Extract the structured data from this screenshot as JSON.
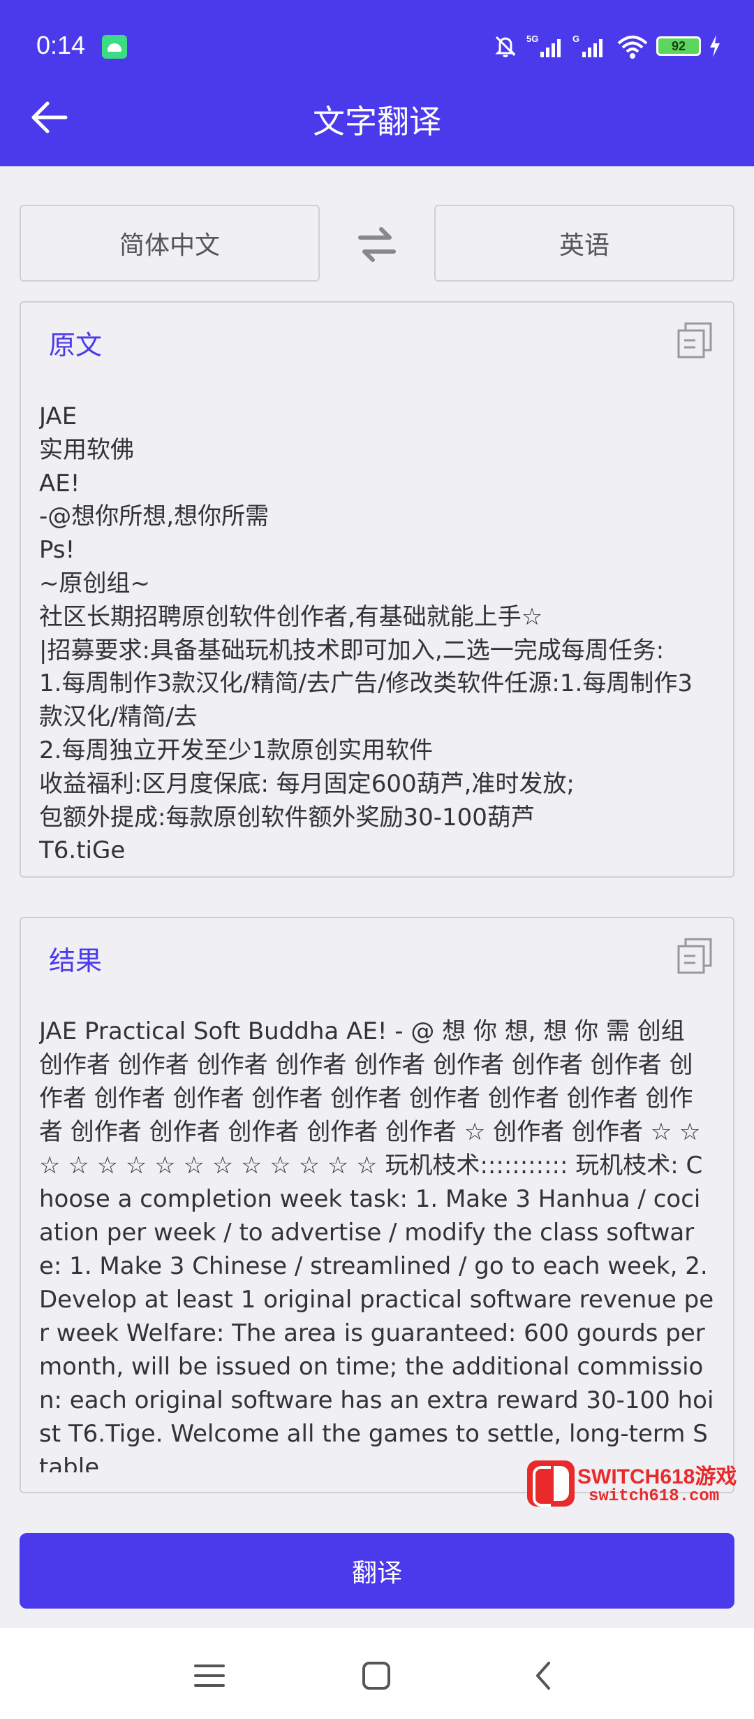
{
  "status_bar": {
    "time": "0:14",
    "battery": "92",
    "icons": [
      "android-icon",
      "mute-icon",
      "signal-5g-icon",
      "signal-g-icon",
      "wifi-icon",
      "charging-icon"
    ]
  },
  "header": {
    "title": "文字翻译",
    "back_icon": "arrow-left-icon"
  },
  "languages": {
    "source": "简体中文",
    "target": "英语",
    "swap_icon": "swap-arrows-icon"
  },
  "source_panel": {
    "title": "原文",
    "copy_icon": "copy-icon",
    "text": "JAE\n实用软佛\nAE!\n-@想你所想,想你所需\nPs!\n~原创组~\n社区长期招聘原创软件创作者,有基础就能上手☆\n|招募要求:具备基础玩机技术即可加入,二选一完成每周任务:\n1.每周制作3款汉化/精简/去广告/修改类软件任源:1.每周制作3款汉化/精简/去\n2.每周独立开发至少1款原创实用软件\n收益福利:区月度保底: 每月固定600葫芦,准时发放;\n包额外提成:每款原创软件额外奖励30-100葫芦\nT6.tiGe"
  },
  "result_panel": {
    "title": "结果",
    "copy_icon": "copy-icon",
    "text": "JAE Practical Soft Buddha AE! - @ 想 你 想, 想 你 需 创组 创作者 创作者 创作者 创作者 创作者 创作者 创作者 创作者 创作者 创作者 创作者 创作者 创作者 创作者 创作者 创作者 创作者 创作者 创作者 创作者 创作者 创作者 ☆ 创作者 创作者 ☆ ☆ ☆ ☆ ☆ ☆ ☆ ☆ ☆ ☆ ☆ ☆ ☆ ☆ 玩机枝术::::::::::: 玩机枝术: Choose a completion week task: 1. Make 3 Hanhua / cociation per week / to advertise / modify the class software: 1. Make 3 Chinese / streamlined / go to each week, 2. Develop at least 1 original practical software revenue per week Welfare: The area is guaranteed: 600 gourds per month, will be issued on time; the additional commission: each original software has an extra reward 30-100 hoist T6.Tige. Welcome all the games to settle, long-term Stable"
  },
  "actions": {
    "translate_label": "翻译"
  },
  "watermark": {
    "line1": "SWITCH618游戏",
    "line2": "switch618.com"
  },
  "nav_bar": {
    "icons": [
      "menu-icon",
      "home-icon",
      "back-icon"
    ]
  },
  "colors": {
    "primary": "#4a3aeb",
    "background": "#efeff4",
    "border": "#cfcfd6",
    "watermark": "#e82a2a"
  }
}
